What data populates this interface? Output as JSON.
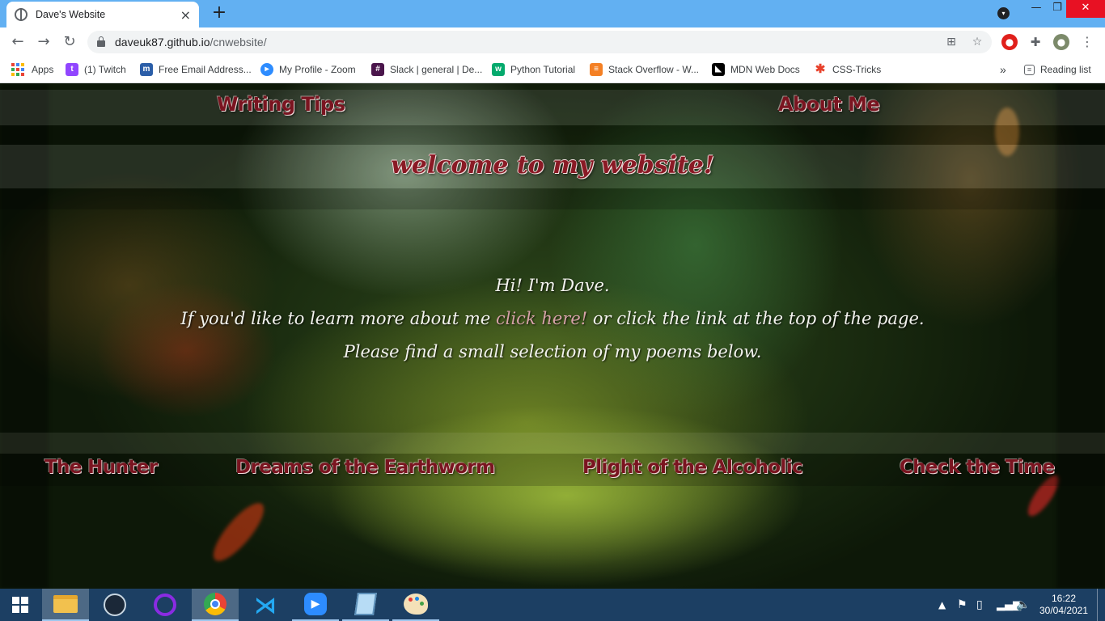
{
  "browser": {
    "tab_title": "Dave's Website",
    "tab_close": "×",
    "new_tab": "+",
    "url_domain": "daveuk87.github.io",
    "url_path": "/cnwebsite/",
    "window_controls": {
      "minimize": "—",
      "maximize": "❐",
      "close": "✕"
    }
  },
  "bookmarks": [
    {
      "label": "Apps",
      "icon": "apps-grid-icon"
    },
    {
      "label": "(1) Twitch",
      "icon": "twitch-icon",
      "color": "#9146ff"
    },
    {
      "label": "Free Email Address...",
      "icon": "mail-icon",
      "color": "#2b5ea8"
    },
    {
      "label": "My Profile - Zoom",
      "icon": "zoom-icon",
      "color": "#2d8cff"
    },
    {
      "label": "Slack | general | De...",
      "icon": "slack-icon",
      "color": "#4a154b"
    },
    {
      "label": "Python Tutorial",
      "icon": "w3schools-icon",
      "color": "#04aa6d"
    },
    {
      "label": "Stack Overflow - W...",
      "icon": "stackoverflow-icon",
      "color": "#f48024"
    },
    {
      "label": "MDN Web Docs",
      "icon": "mdn-icon",
      "color": "#000000"
    },
    {
      "label": "CSS-Tricks",
      "icon": "css-tricks-icon",
      "color": "#e8412b"
    }
  ],
  "bookmarks_overflow": "»",
  "reading_list": "Reading list",
  "site": {
    "nav_writing_tips": "Writing Tips",
    "nav_about_me": "About Me",
    "welcome": "welcome to my website!",
    "intro_line1": "Hi! I'm Dave.",
    "intro_line2_before": "If you'd like to learn more about me",
    "intro_line2_link": "click here!",
    "intro_line2_after": "or click the link at the top of the page.",
    "intro_line3": "Please find a small selection of my poems below.",
    "poems": [
      "The Hunter",
      "Dreams of the Earthworm",
      "Plight of the Alcoholic",
      "Check the Time"
    ]
  },
  "taskbar": {
    "time": "16:22",
    "date": "30/04/2021"
  },
  "colors": {
    "titlebar": "#62b0f2",
    "link_red": "#7a1420",
    "taskbar": "#1c3f63"
  }
}
